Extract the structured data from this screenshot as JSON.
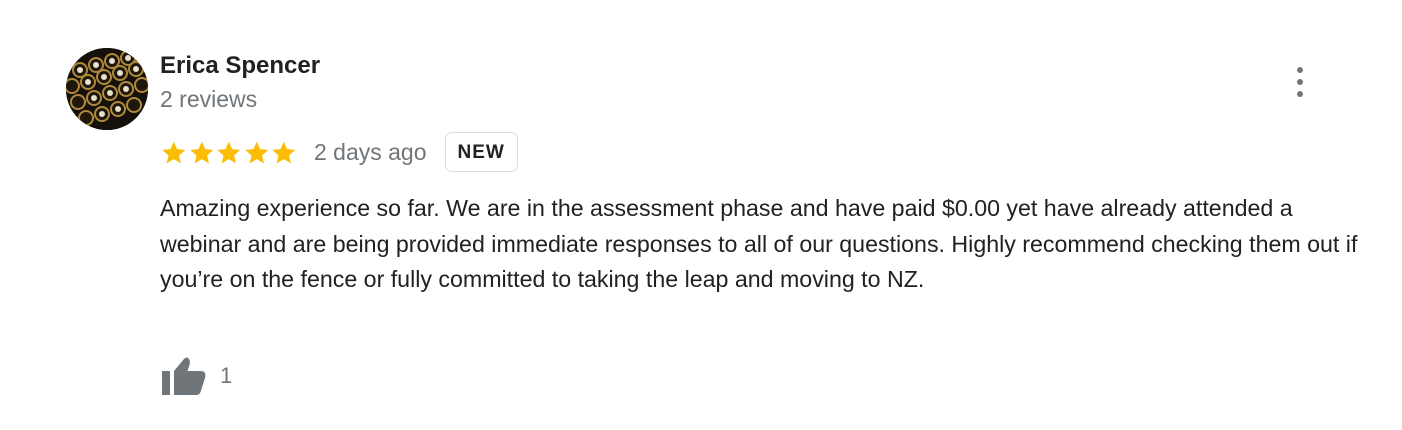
{
  "review": {
    "author_name": "Erica Spencer",
    "review_count": "2 reviews",
    "rating": 5,
    "rating_max": 5,
    "date": "2 days ago",
    "badge": "NEW",
    "text": "Amazing experience so far. We are in the assessment phase and have paid $0.00 yet have already attended a webinar and are being provided immediate responses to all of our questions. Highly recommend checking them out if you’re on the fence or fully committed to taking the leap and moving to NZ.",
    "like_count": "1"
  },
  "icons": {
    "avatar": "typewriter-keys-avatar",
    "star": "star-icon",
    "more": "more-vert-icon",
    "like": "thumbs-up-icon"
  },
  "colors": {
    "star": "#fbbc04",
    "secondary_text": "#70757a",
    "primary_text": "#202124",
    "badge_border": "#dadce0",
    "like_icon": "#70757a"
  }
}
